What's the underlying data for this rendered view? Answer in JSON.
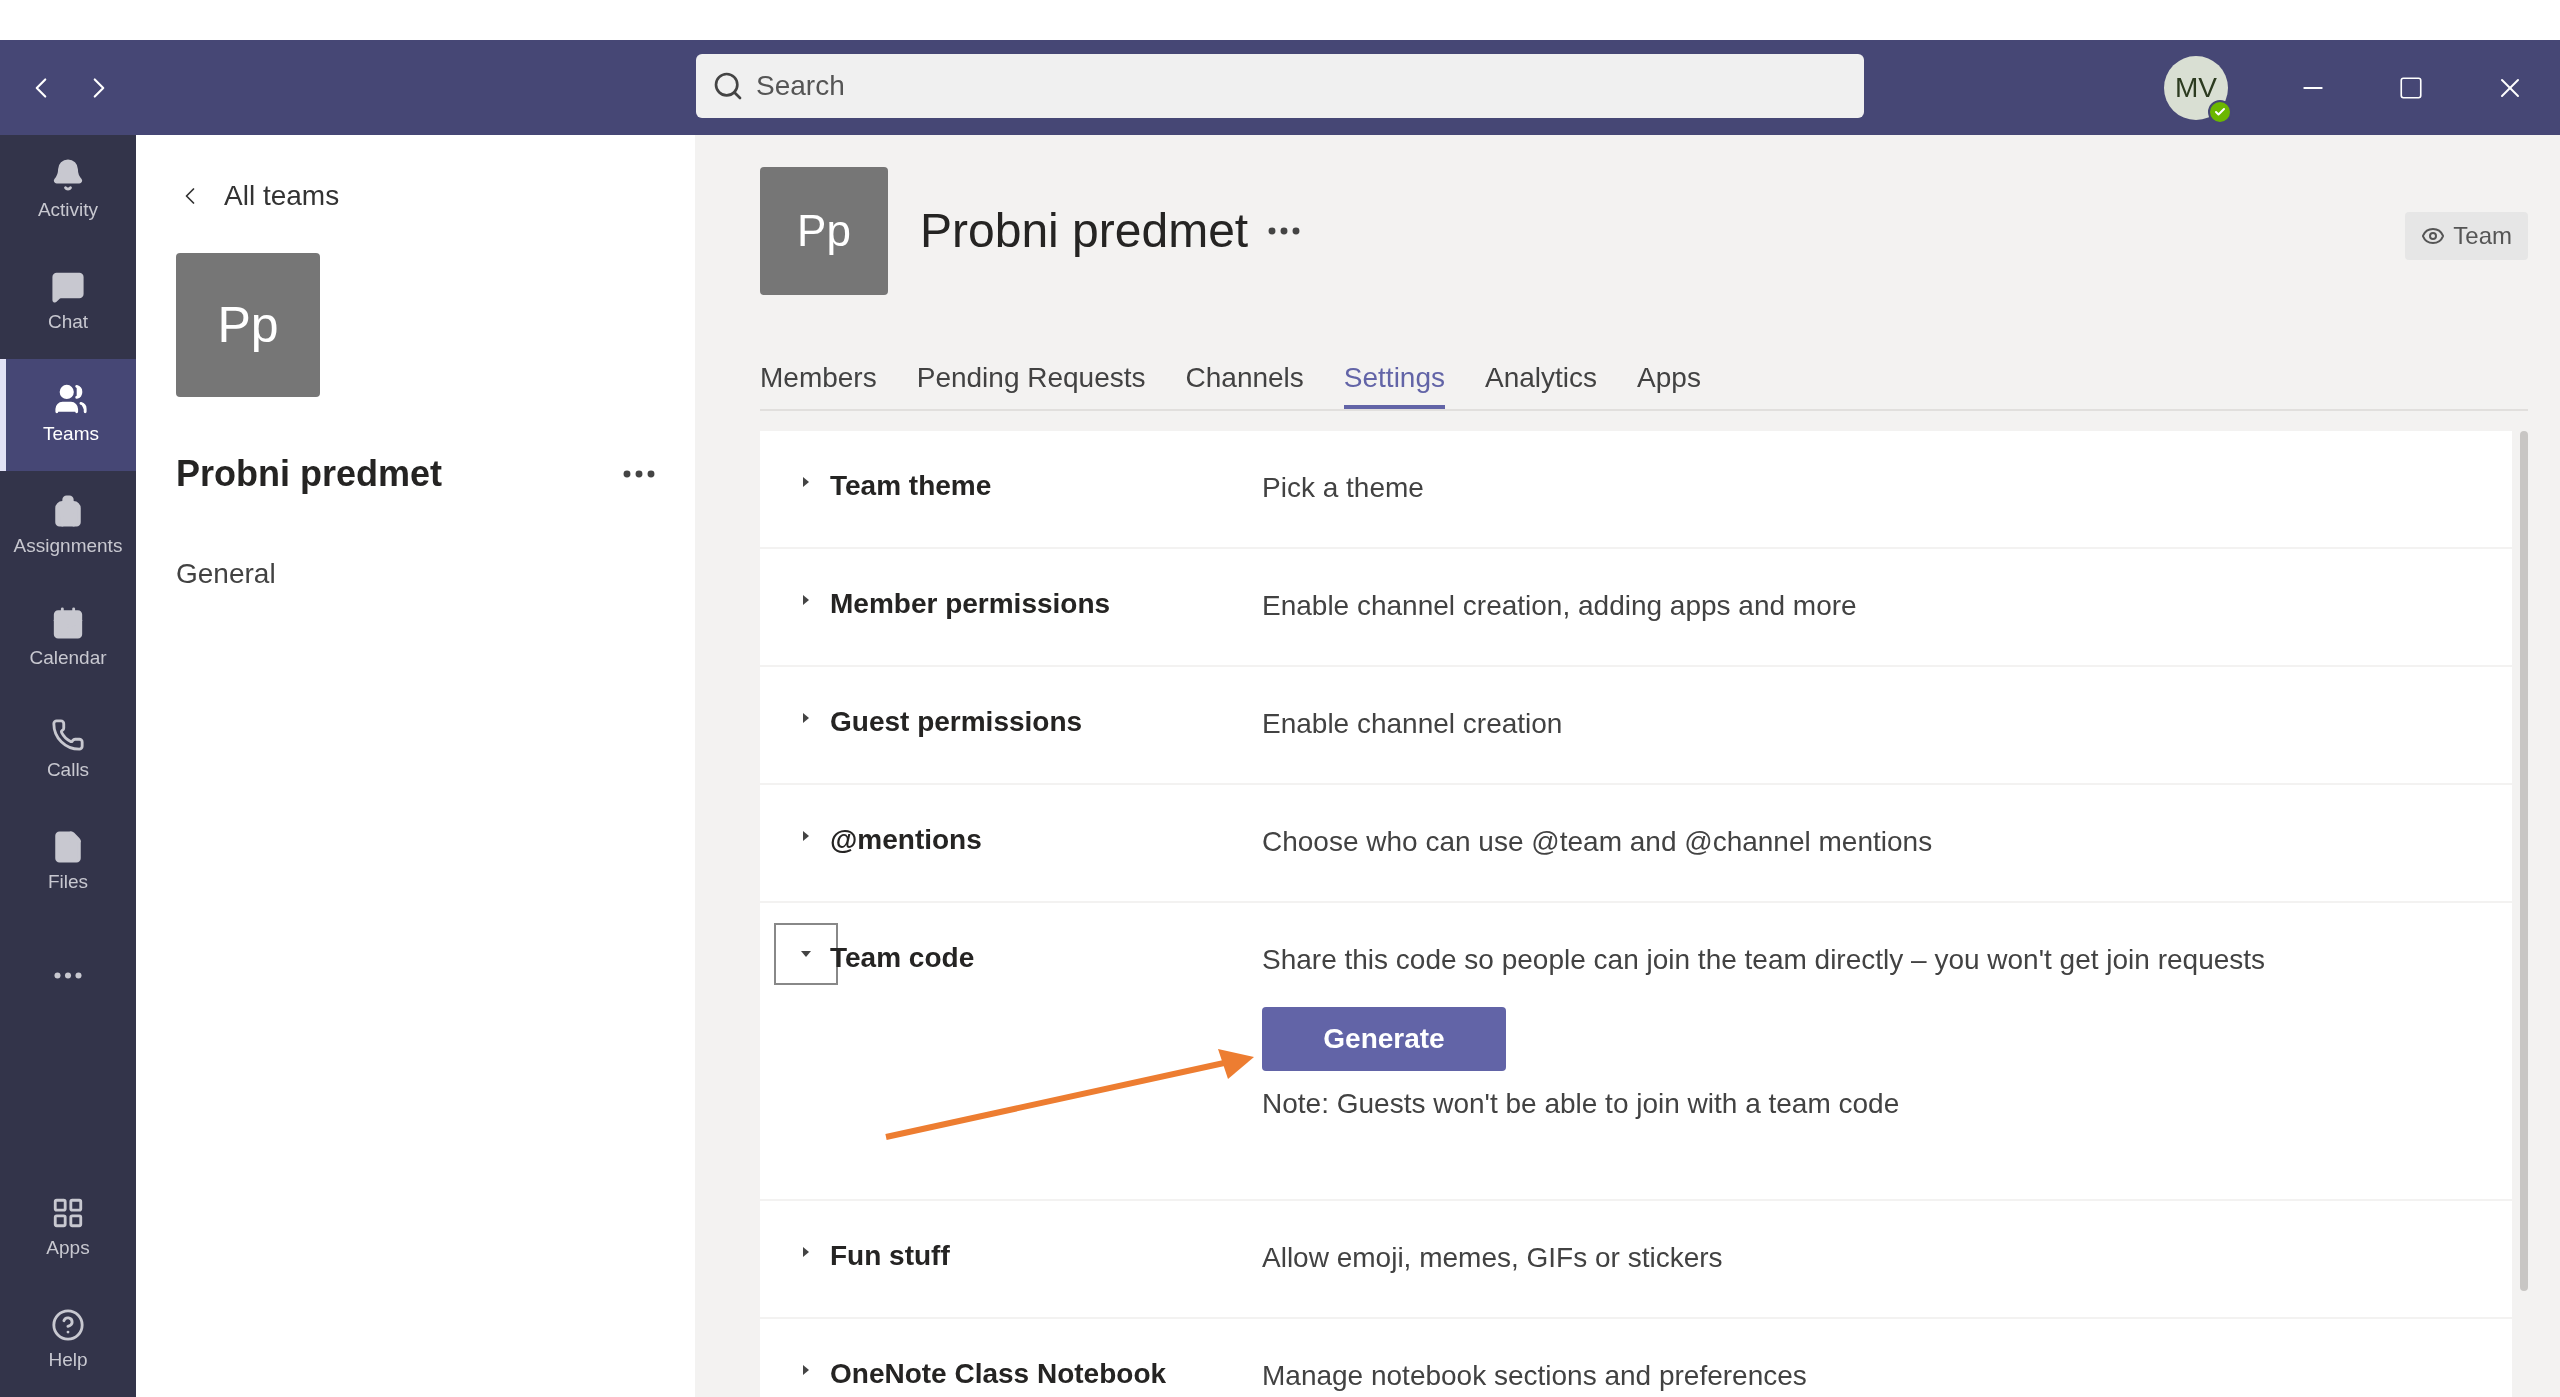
{
  "title_bar": {
    "search": {
      "placeholder": "Search"
    },
    "avatar": {
      "initials": "MV"
    }
  },
  "rail": [
    {
      "kind": "activity",
      "label": "Activity",
      "selected": false
    },
    {
      "kind": "chat",
      "label": "Chat",
      "selected": false
    },
    {
      "kind": "teams",
      "label": "Teams",
      "selected": true
    },
    {
      "kind": "assignments",
      "label": "Assignments",
      "selected": false
    },
    {
      "kind": "calendar",
      "label": "Calendar",
      "selected": false
    },
    {
      "kind": "calls",
      "label": "Calls",
      "selected": false
    },
    {
      "kind": "files",
      "label": "Files",
      "selected": false
    },
    {
      "kind": "more",
      "selected": false
    },
    {
      "kind": "apps",
      "label": "Apps",
      "selected": false
    },
    {
      "kind": "help",
      "label": "Help",
      "selected": false
    }
  ],
  "team_panel": {
    "back_link": "All teams",
    "avatar": "Pp",
    "name": "Probni predmet",
    "channels": [
      "General"
    ]
  },
  "header": {
    "avatar": "Pp",
    "name": "Probni predmet",
    "badge": "Team"
  },
  "tabs": [
    {
      "label": "Members",
      "selected": false
    },
    {
      "label": "Pending Requests",
      "selected": false
    },
    {
      "label": "Channels",
      "selected": false
    },
    {
      "label": "Settings",
      "selected": true
    },
    {
      "label": "Analytics",
      "selected": false
    },
    {
      "label": "Apps",
      "selected": false
    }
  ],
  "settings": [
    {
      "title": "Team theme",
      "description": "Pick a theme",
      "expanded": false
    },
    {
      "title": "Member permissions",
      "description": "Enable channel creation, adding apps and more",
      "expanded": false
    },
    {
      "title": "Guest permissions",
      "description": "Enable channel creation",
      "expanded": false
    },
    {
      "title": "@mentions",
      "description": "Choose who can use @team and @channel mentions",
      "expanded": false
    },
    {
      "title": "Team code",
      "description": "Share this code so people can join the team directly – you won't get join requests",
      "expanded": true,
      "button": "Generate",
      "note": "Note: Guests won't be able to join with a team code"
    },
    {
      "title": "Fun stuff",
      "description": "Allow emoji, memes, GIFs or stickers",
      "expanded": false
    },
    {
      "title": "OneNote Class Notebook",
      "description": "Manage notebook sections and preferences",
      "expanded": false
    }
  ]
}
